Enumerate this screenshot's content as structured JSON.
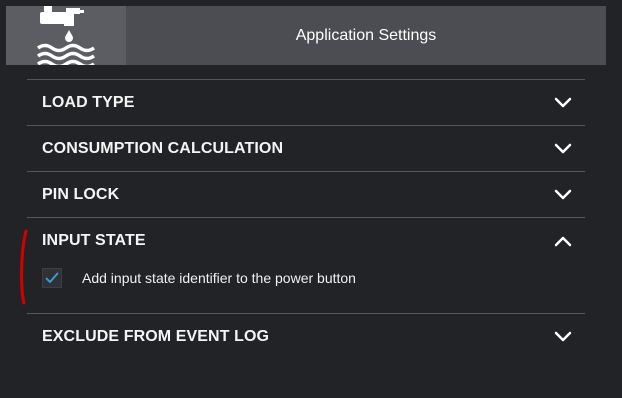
{
  "header": {
    "icon": "water-tap-icon",
    "title": "Application Settings"
  },
  "sections": [
    {
      "label": "LOAD TYPE",
      "expanded": false
    },
    {
      "label": "CONSUMPTION CALCULATION",
      "expanded": false
    },
    {
      "label": "PIN LOCK",
      "expanded": false
    },
    {
      "label": "INPUT STATE",
      "expanded": true,
      "option": {
        "label": "Add input state identifier to the power button",
        "checked": true
      }
    },
    {
      "label": "EXCLUDE FROM EVENT LOG",
      "expanded": false
    }
  ],
  "colors": {
    "background": "#222326",
    "header": "#4b4d52",
    "header_icon_box": "#5b5d62",
    "checkmark": "#3aa0e6",
    "annotation": "#d40000"
  }
}
